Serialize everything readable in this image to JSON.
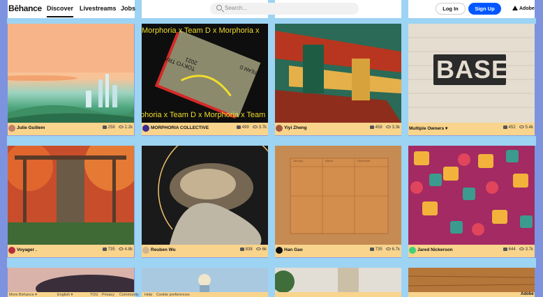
{
  "header": {
    "logo": "Bēhance",
    "nav": [
      "Discover",
      "Livestreams",
      "Jobs"
    ],
    "search_placeholder": "Search...",
    "login_label": "Log In",
    "signup_label": "Sign Up",
    "adobe_label": "Adobe"
  },
  "projects": [
    {
      "owner": "Julie Guillem",
      "likes": "258",
      "views": "2.2k",
      "art": "landscape"
    },
    {
      "owner": "MORPHORIA COLLECTIVE",
      "likes": "499",
      "views": "3.7k",
      "art": "book",
      "banner": "Morphoria x Team D x Morphoria x",
      "banner_bottom": "phoria x Team D x Morphoria x Team",
      "book_title": "TOKYO TRACKS 2021",
      "book_sub": "TEAM D"
    },
    {
      "owner": "Yiyi Zheng",
      "likes": "458",
      "views": "3.3k",
      "art": "temple"
    },
    {
      "owner": "Multiple Owners ▾",
      "likes": "452",
      "views": "5.4k",
      "art": "base",
      "sign_text": "BASE"
    },
    {
      "owner": "Voyager .",
      "likes": "735",
      "views": "4.8k",
      "art": "forest"
    },
    {
      "owner": "Reuben Wu",
      "likes": "838",
      "views": "6k",
      "art": "cloud"
    },
    {
      "owner": "Han Gao",
      "likes": "735",
      "views": "6.7k",
      "art": "paper",
      "paper_cols": [
        "January",
        "March",
        "December"
      ]
    },
    {
      "owner": "Jared Nickerson",
      "likes": "644",
      "views": "3.7k",
      "art": "pattern"
    }
  ],
  "footer": {
    "links": [
      "More Behance ▾",
      "English ▾",
      "TOU",
      "Privacy",
      "Community",
      "Help",
      "Cookie preferences"
    ],
    "adobe": "Adobe"
  },
  "colors": {
    "background_band": "#9dd3f3",
    "page_edge": "#8aa0e6",
    "meta_bar": "#f9d48c",
    "signup_blue": "#0057ff"
  }
}
